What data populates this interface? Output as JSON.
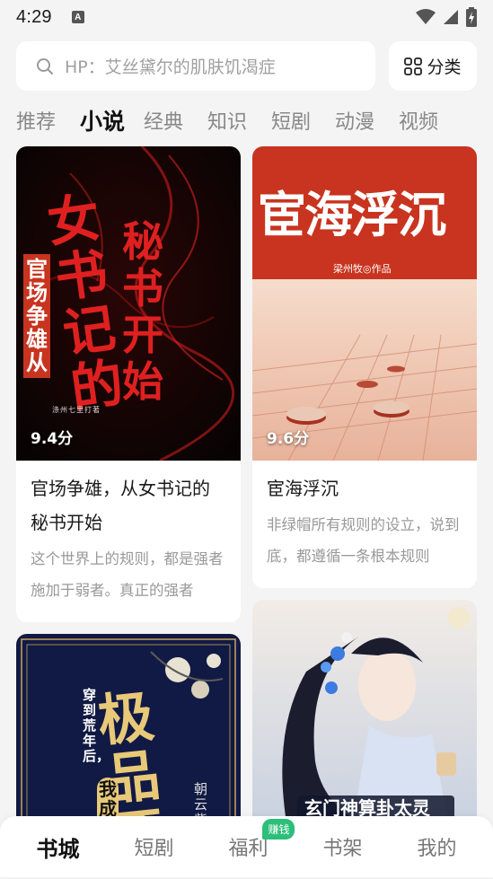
{
  "status": {
    "time": "4:29",
    "notif_icon": "A"
  },
  "search": {
    "placeholder": "HP：艾丝黛尔的肌肤饥渴症",
    "category_label": "分类"
  },
  "tabs": [
    {
      "label": "推荐"
    },
    {
      "label": "小说"
    },
    {
      "label": "经典"
    },
    {
      "label": "知识"
    },
    {
      "label": "短剧"
    },
    {
      "label": "动漫"
    },
    {
      "label": "视频"
    }
  ],
  "active_tab": "小说",
  "books": {
    "b1": {
      "score": "9.4分",
      "title": "官场争雄，从女书记的秘书开始",
      "desc": "这个世界上的规则，都是强者施加于弱者。真正的强者",
      "cover": {
        "big_text": "女书记的",
        "side_text": "官场争雄从",
        "right_text": "秘书开始",
        "author": "涤州七里打著"
      }
    },
    "b2": {
      "score": "9.6分",
      "title": "宦海浮沉",
      "desc": "非绿帽所有规则的设立，说到底，都遵循一条根本规则",
      "cover": {
        "big_text": "宦海浮沉",
        "author": "梁州牧◎作品"
      }
    },
    "b3": {
      "cover": {
        "small_text": "穿到荒年后，",
        "big_text": "极品恶",
        "mid_text": "我成了",
        "author": "朝云紫"
      }
    },
    "b4": {
      "cover": {
        "banner_text": "玄门神算卦太灵"
      }
    }
  },
  "bottom_nav": [
    {
      "label": "书城"
    },
    {
      "label": "短剧"
    },
    {
      "label": "福利"
    },
    {
      "label": "书架"
    },
    {
      "label": "我的"
    }
  ],
  "nav_badge": "赚钱",
  "colors": {
    "accent_green": "#2bbf7a",
    "cover_red": "#c8341f",
    "bg": "#f4f4f5"
  }
}
